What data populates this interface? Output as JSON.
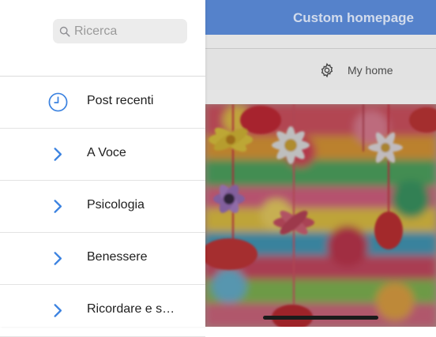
{
  "app": {
    "title": "Custom homepage",
    "home_button_label": "My home"
  },
  "drawer": {
    "search": {
      "placeholder": "Ricerca",
      "value": ""
    },
    "items": [
      {
        "label": "Post recenti",
        "icon": "clock-icon"
      },
      {
        "label": "A Voce",
        "icon": "chevron-right-icon"
      },
      {
        "label": "Psicologia",
        "icon": "chevron-right-icon"
      },
      {
        "label": "Benessere",
        "icon": "chevron-right-icon"
      },
      {
        "label": "Ricordare e s…",
        "icon": "chevron-right-icon"
      }
    ]
  },
  "colors": {
    "accent": "#3b82e0",
    "header_bg": "#5b8bd8"
  }
}
